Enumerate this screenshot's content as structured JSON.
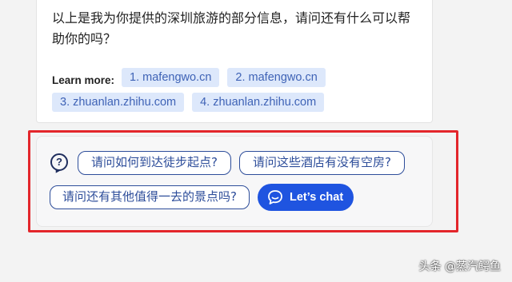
{
  "answer": {
    "text": "以上是我为你提供的深圳旅游的部分信息，请问还有什么可以帮助你的吗？"
  },
  "learn_more": {
    "label": "Learn more:",
    "sources": [
      "1. mafengwo.cn",
      "2. mafengwo.cn",
      "3. zhuanlan.zhihu.com",
      "4. zhuanlan.zhihu.com"
    ]
  },
  "suggestions": {
    "icon": "question-bubble-icon",
    "items": [
      "请问如何到达徒步起点?",
      "请问这些酒店有没有空房?",
      "请问还有其他值得一去的景点吗?"
    ],
    "chat_button": "Let’s chat",
    "chat_icon": "chat-bubble-icon"
  },
  "watermark": "头条 @蒸汽鳄鱼",
  "colors": {
    "highlight": "#e3262b",
    "chip_bg": "#dde8fb",
    "chip_text": "#3f63b6",
    "suggest_border": "#2d4d9a",
    "chat_button": "#1f54e0"
  }
}
